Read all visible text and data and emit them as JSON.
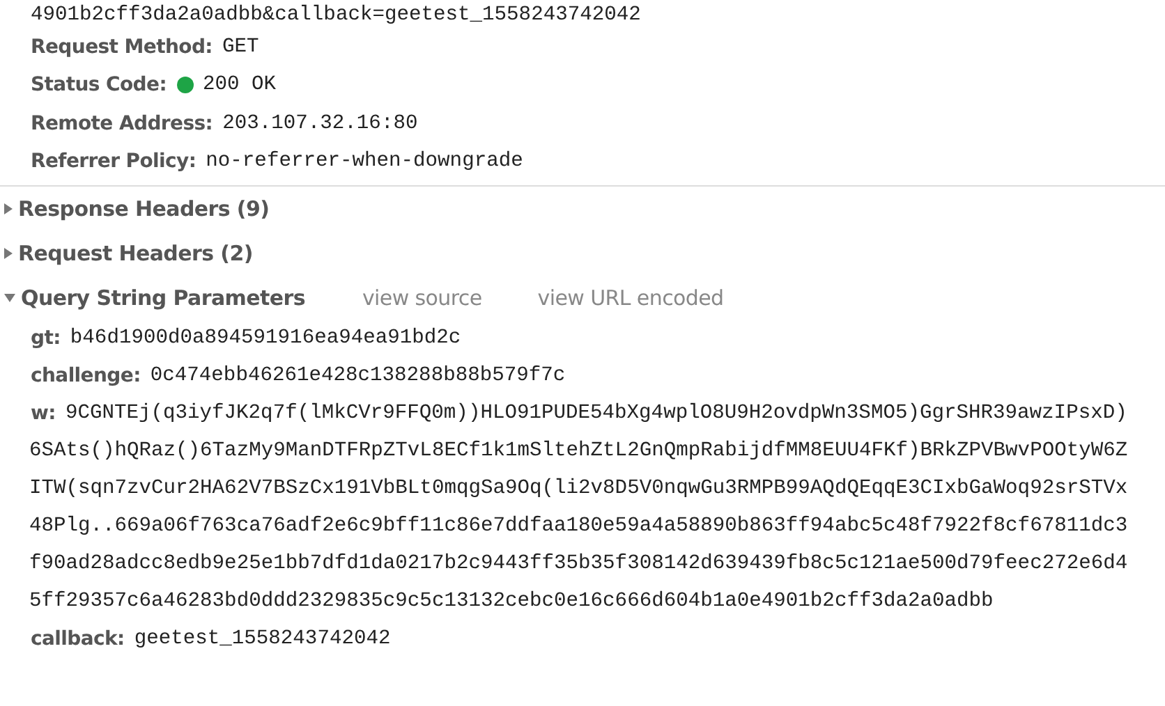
{
  "url_tail": "4901b2cff3da2a0adbb&callback=geetest_1558243742042",
  "general": [
    {
      "label": "Request Method:",
      "value": "GET",
      "status_dot": false
    },
    {
      "label": "Status Code:",
      "value": "200 OK",
      "status_dot": true,
      "color": "#1ea446"
    },
    {
      "label": "Remote Address:",
      "value": "203.107.32.16:80",
      "status_dot": false
    },
    {
      "label": "Referrer Policy:",
      "value": "no-referrer-when-downgrade",
      "status_dot": false
    }
  ],
  "sections": [
    {
      "title": "Response Headers (9)",
      "expanded": false
    },
    {
      "title": "Request Headers (2)",
      "expanded": false
    },
    {
      "title": "Query String Parameters",
      "expanded": true,
      "links": [
        "view source",
        "view URL encoded"
      ]
    }
  ],
  "params": [
    {
      "name": "gt:",
      "lines": [
        "b46d1900d0a894591916ea94ea91bd2c"
      ]
    },
    {
      "name": "challenge:",
      "lines": [
        "0c474ebb46261e428c138288b88b579f7c"
      ]
    },
    {
      "name": "w:",
      "lines": [
        "9CGNTEj(q3iyfJK2q7f(lMkCVr9FFQ0m))HLO91PUDE54bXg4wplO8U9H2ovdpWn3SMO5)GgrSHR39awzIPsxD)",
        "6SAts()hQRaz()6TazMy9ManDTFRpZTvL8ECf1k1mSltehZtL2GnQmpRabijdfMM8EUU4FKf)BRkZPVBwvPOOtyW6Z",
        "ITW(sqn7zvCur2HA62V7BSzCx191VbBLt0mqgSa9Oq(li2v8D5V0nqwGu3RMPB99AQdQEqqE3CIxbGaWoq92srSTVx",
        "48Plg..669a06f763ca76adf2e6c9bff11c86e7ddfaa180e59a4a58890b863ff94abc5c48f7922f8cf67811dc3",
        "f90ad28adcc8edb9e25e1bb7dfd1da0217b2c9443ff35b35f308142d639439fb8c5c121ae500d79feec272e6d4",
        "5ff29357c6a46283bd0ddd2329835c9c5c13132cebc0e16c666d604b1a0e4901b2cff3da2a0adbb"
      ]
    },
    {
      "name": "callback:",
      "lines": [
        "geetest_1558243742042"
      ]
    }
  ]
}
